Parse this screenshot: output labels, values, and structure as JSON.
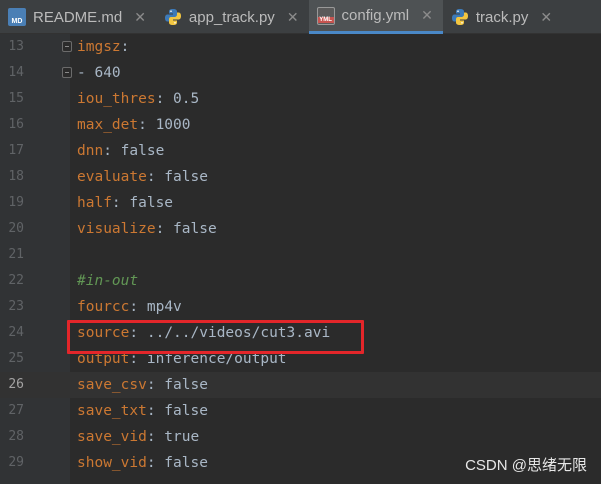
{
  "tabs": [
    {
      "label": "README.md",
      "icon": "markdown-file-icon",
      "active": false
    },
    {
      "label": "app_track.py",
      "icon": "python-file-icon",
      "active": false
    },
    {
      "label": "config.yml",
      "icon": "yaml-file-icon",
      "active": true
    },
    {
      "label": "track.py",
      "icon": "python-file-icon",
      "active": false
    }
  ],
  "close_glyph": "✕",
  "editor": {
    "current_line": 26,
    "lines": [
      {
        "num": "13",
        "key": "imgsz",
        "sep": ":",
        "value": "",
        "comment": ""
      },
      {
        "num": "14",
        "key": "",
        "sep": "",
        "value": "- 640",
        "comment": ""
      },
      {
        "num": "15",
        "key": "iou_thres",
        "sep": ":",
        "value": " 0.5",
        "comment": ""
      },
      {
        "num": "16",
        "key": "max_det",
        "sep": ":",
        "value": " 1000",
        "comment": ""
      },
      {
        "num": "17",
        "key": "dnn",
        "sep": ":",
        "value": " false",
        "comment": ""
      },
      {
        "num": "18",
        "key": "evaluate",
        "sep": ":",
        "value": " false",
        "comment": ""
      },
      {
        "num": "19",
        "key": "half",
        "sep": ":",
        "value": " false",
        "comment": ""
      },
      {
        "num": "20",
        "key": "visualize",
        "sep": ":",
        "value": " false",
        "comment": ""
      },
      {
        "num": "21",
        "key": "",
        "sep": "",
        "value": "",
        "comment": ""
      },
      {
        "num": "22",
        "key": "",
        "sep": "",
        "value": "",
        "comment": "#in-out"
      },
      {
        "num": "23",
        "key": "fourcc",
        "sep": ":",
        "value": " mp4v",
        "comment": ""
      },
      {
        "num": "24",
        "key": "source",
        "sep": ":",
        "value": " ../../videos/cut3.avi",
        "comment": ""
      },
      {
        "num": "25",
        "key": "output",
        "sep": ":",
        "value": " inference/output",
        "comment": ""
      },
      {
        "num": "26",
        "key": "save_csv",
        "sep": ":",
        "value": " false",
        "comment": ""
      },
      {
        "num": "27",
        "key": "save_txt",
        "sep": ":",
        "value": " false",
        "comment": ""
      },
      {
        "num": "28",
        "key": "save_vid",
        "sep": ":",
        "value": " true",
        "comment": ""
      },
      {
        "num": "29",
        "key": "show_vid",
        "sep": ":",
        "value": " false",
        "comment": ""
      }
    ]
  },
  "watermark": "CSDN @思绪无限",
  "colors": {
    "key": "#cc7832",
    "value": "#a9b7c6",
    "comment": "#629755",
    "highlight": "#e3262a",
    "background": "#2b2b2b"
  }
}
